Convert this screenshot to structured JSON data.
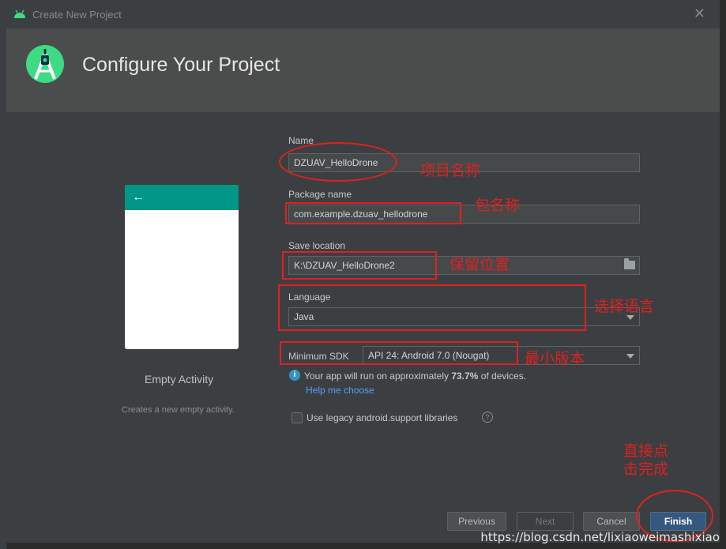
{
  "window": {
    "title": "Create New Project"
  },
  "header": {
    "title": "Configure Your Project"
  },
  "template": {
    "name": "Empty Activity",
    "description": "Creates a new empty activity.",
    "back_glyph": "←"
  },
  "form": {
    "name_label": "Name",
    "name_value": "DZUAV_HelloDrone",
    "package_label": "Package name",
    "package_value": "com.example.dzuav_hellodrone",
    "save_label": "Save location",
    "save_value": "K:\\DZUAV_HelloDrone2",
    "language_label": "Language",
    "language_value": "Java",
    "minsdk_label": "Minimum SDK",
    "minsdk_value": "API 24: Android 7.0 (Nougat)",
    "info_prefix": "Your app will run on approximately ",
    "info_percent": "73.7%",
    "info_suffix": " of devices.",
    "help_link": "Help me choose",
    "legacy_label": "Use legacy android.support libraries"
  },
  "buttons": {
    "previous": "Previous",
    "next": "Next",
    "cancel": "Cancel",
    "finish": "Finish"
  },
  "annotations": {
    "project_name": "项目名称",
    "package_name": "包名称",
    "save_location": "保留位置",
    "language": "选择语言",
    "min_version": "最小版本",
    "finish_line1": "直接点",
    "finish_line2": "击完成"
  },
  "watermark": "https://blog.csdn.net/lixiaoweimashixiao",
  "colors": {
    "dialog_bg": "#3c3f41",
    "header_bg": "#4b4d4d",
    "accent_teal": "#009688",
    "annotation_red": "#e02020",
    "primary_button": "#365880"
  }
}
